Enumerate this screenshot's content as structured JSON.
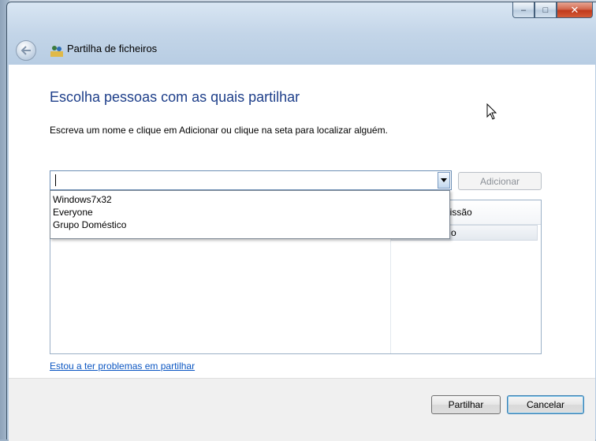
{
  "window": {
    "title": "Partilha de ficheiros",
    "caption_buttons": {
      "minimize": "–",
      "maximize": "□",
      "close": "✕"
    }
  },
  "content": {
    "heading": "Escolha pessoas com as quais partilhar",
    "instruction": "Escreva um nome e clique em Adicionar ou clique na seta para localizar alguém.",
    "name_input": {
      "value": "",
      "placeholder": ""
    },
    "add_button": "Adicionar",
    "dropdown_options": [
      "Windows7x32",
      "Everyone",
      "Grupo Doméstico"
    ],
    "list": {
      "column_permission": "ermissão",
      "row_permission_partial": "o"
    },
    "help_link": "Estou a ter problemas em partilhar"
  },
  "footer": {
    "share_button": "Partilhar",
    "cancel_button": "Cancelar"
  },
  "colors": {
    "heading": "#1e3f8a",
    "link": "#0b56c2",
    "close_button": "#c0391b"
  },
  "icons": [
    "back-arrow-icon",
    "file-sharing-users-icon",
    "dropdown-arrow-icon",
    "mouse-pointer-icon"
  ]
}
